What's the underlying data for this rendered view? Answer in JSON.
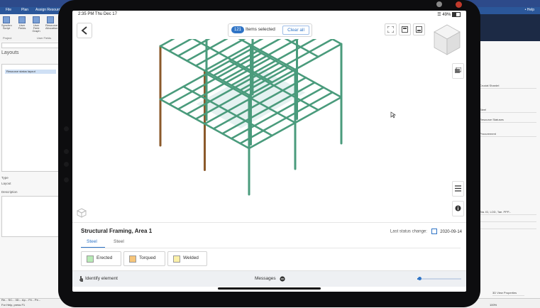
{
  "desktop": {
    "ribbon_tabs": [
      "File",
      "Plan",
      "Assign Resource"
    ],
    "help_label": "• Help",
    "ribbon_buttons": [
      "Synchro Script",
      "User Fields",
      "User Field Graph",
      "Resource Allocation"
    ],
    "ribbon_groups": [
      "Project",
      "User Fields"
    ],
    "layouts_title": "Layouts",
    "layout_item": "Resource status layout",
    "type_label": "Type",
    "type_value": "Layout",
    "description_label": "Description",
    "right_rows": [
      "Crucial Shardel",
      "Steel",
      "Resource Statuses",
      "Procurement"
    ],
    "right_note": "Sta. ID, LOD, Tae. PPP...",
    "right_bottom": "3D View Properties",
    "status_left": "Re... SC... 3D... Ap... Fil... Pe...",
    "status_help": "For Help, press F1",
    "zoom": "100%"
  },
  "tablet": {
    "status": {
      "time": "2:35 PM  Thu Dec 17",
      "battery": "49%"
    },
    "selection": {
      "count": "121",
      "label": "Items selected",
      "clear": "Clear all"
    },
    "panel": {
      "title": "Structural Framing, Area 1",
      "last_change_label": "Last status change:",
      "last_change_date": "2020-09-14",
      "tabs": [
        "Steel",
        "Steel"
      ],
      "statuses": [
        {
          "label": "Erected",
          "color": "#b7eab5"
        },
        {
          "label": "Torqued",
          "color": "#f6c57a"
        },
        {
          "label": "Welded",
          "color": "#fbf0a8"
        }
      ]
    },
    "footer": {
      "identify": "Identify element",
      "messages": "Messages",
      "slider_progress": 0.05
    },
    "colors": {
      "accent": "#2f74c6",
      "steel_green": "#4a9b7c",
      "steel_brown": "#8b5a2b"
    }
  }
}
